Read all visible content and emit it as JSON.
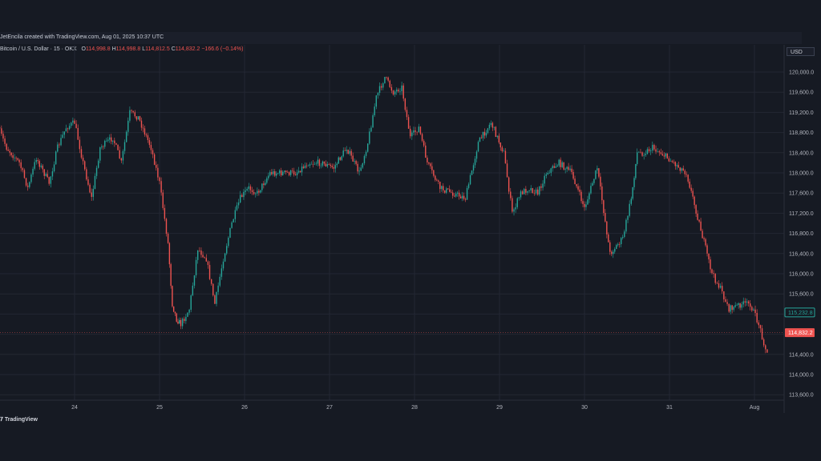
{
  "header": {
    "credit": "JetEncila created with TradingView.com, Aug 01, 2025 10:37 UTC",
    "symbol": "Bitcoin / U.S. Dollar · 15 · OKX",
    "ohlc": [
      {
        "label": "O",
        "value": "114,998.8"
      },
      {
        "label": "H",
        "value": "114,998.8"
      },
      {
        "label": "L",
        "value": "114,812.5"
      },
      {
        "label": "C",
        "value": "114,832.2"
      },
      {
        "label": "",
        "value": "−166.6 (−0.14%)"
      }
    ],
    "currency": "USD"
  },
  "footer": {
    "brand": "TradingView"
  },
  "colors": {
    "background": "#161a23",
    "grid": "#232733",
    "up": "#26a69a",
    "down": "#ef5350",
    "axis_text": "#b2b5be"
  },
  "chart_data": {
    "type": "line",
    "style": "candlestick",
    "x_labels": [
      "24",
      "25",
      "26",
      "27",
      "28",
      "29",
      "30",
      "31",
      "Aug"
    ],
    "y_ticks": [
      "120,000.0",
      "119,600.0",
      "119,200.0",
      "118,800.0",
      "118,400.0",
      "118,000.0",
      "117,600.0",
      "117,200.0",
      "116,800.0",
      "116,400.0",
      "116,000.0",
      "115,600.0",
      "115,200.0",
      "114,800.0",
      "114,400.0",
      "114,000.0",
      "113,600.0"
    ],
    "ylim": [
      113500,
      120400
    ],
    "grid": true,
    "badges": [
      {
        "value": 115232.8,
        "label": "115,232.8",
        "color": "#26a69a",
        "style": "outline"
      },
      {
        "value": 114832.2,
        "label": "114,832.2",
        "color": "#ef5350",
        "style": "filled"
      }
    ],
    "series": [
      {
        "x": [
          23.1,
          23.2,
          23.35,
          23.45,
          23.55,
          23.7,
          23.8,
          23.9,
          24.0,
          24.1,
          24.2,
          24.3,
          24.45,
          24.55,
          24.65,
          24.75,
          24.9,
          25.0,
          25.1,
          25.15,
          25.2,
          25.25,
          25.35,
          25.45,
          25.55,
          25.65,
          25.75,
          25.85,
          25.95,
          26.05,
          26.15,
          26.3,
          26.45,
          26.6,
          26.75,
          26.9,
          27.05,
          27.2,
          27.35,
          27.45,
          27.55,
          27.65,
          27.75,
          27.85,
          27.95,
          28.05,
          28.15,
          28.3,
          28.45,
          28.6,
          28.75,
          28.9,
          29.05,
          29.15,
          29.25,
          29.35,
          29.45,
          29.55,
          29.7,
          29.85,
          30.0,
          30.15,
          30.3,
          30.45,
          30.55,
          30.62,
          30.7,
          30.8,
          30.9,
          31.05,
          31.2,
          31.35,
          31.5,
          31.6,
          31.7,
          31.85,
          31.95,
          32.05,
          32.15
        ],
        "values": [
          118900,
          118500,
          118200,
          117700,
          118300,
          117800,
          118500,
          118900,
          119000,
          118200,
          117500,
          118500,
          118700,
          118200,
          119200,
          119100,
          118500,
          117800,
          116600,
          115400,
          115100,
          115000,
          115300,
          116500,
          116300,
          115400,
          116300,
          117000,
          117500,
          117700,
          117600,
          118000,
          118000,
          118000,
          118200,
          118200,
          118100,
          118500,
          118000,
          118600,
          119500,
          119900,
          119600,
          119700,
          118700,
          118900,
          118200,
          117700,
          117600,
          117500,
          118600,
          119000,
          118400,
          117200,
          117600,
          117700,
          117600,
          118000,
          118200,
          118000,
          117300,
          118100,
          116400,
          116700,
          117500,
          118400,
          118400,
          118500,
          118400,
          118200,
          118000,
          117000,
          116000,
          115700,
          115300,
          115400,
          115400,
          115000,
          114400
        ]
      }
    ]
  }
}
